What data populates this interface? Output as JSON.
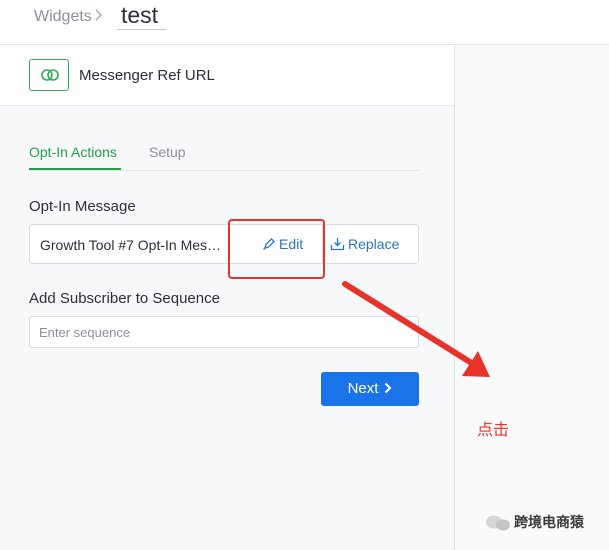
{
  "breadcrumb": {
    "parent": "Widgets",
    "separator": "›",
    "current": "test"
  },
  "panel": {
    "title": "Messenger Ref URL",
    "icon": "link-icon"
  },
  "tabs": [
    {
      "label": "Opt-In Actions",
      "active": true
    },
    {
      "label": "Setup",
      "active": false
    }
  ],
  "optin": {
    "label": "Opt-In Message",
    "value": "Growth Tool #7 Opt-In Message",
    "edit_label": "Edit",
    "replace_label": "Replace"
  },
  "sequence": {
    "label": "Add Subscriber to Sequence",
    "placeholder": "Enter sequence"
  },
  "next_label": "Next",
  "annotation": {
    "text": "点击",
    "color": "#e8332a"
  },
  "watermark": "跨境电商猿",
  "colors": {
    "accent_green": "#24a148",
    "link_blue": "#2a74c9",
    "primary_blue": "#1a73e8"
  }
}
